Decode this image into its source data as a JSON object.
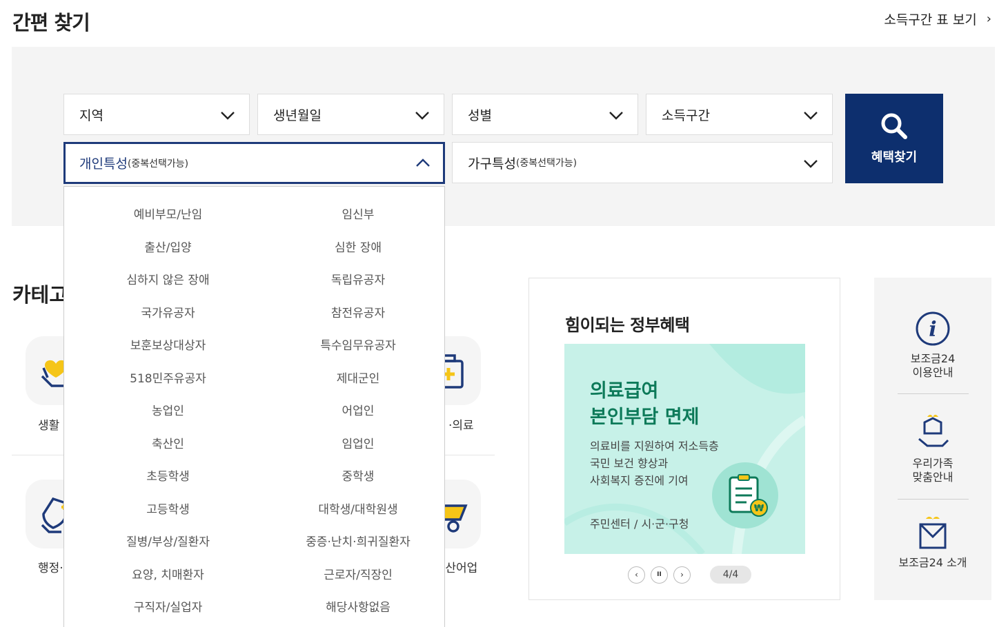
{
  "header": {
    "title": "간편 찾기",
    "income_table_link": "소득구간 표 보기",
    "link_chevron": "›"
  },
  "filters": {
    "region": "지역",
    "birthdate": "생년월일",
    "gender": "성별",
    "income": "소득구간",
    "personal": {
      "label": "개인특성",
      "sub": "(중복선택가능)"
    },
    "household": {
      "label": "가구특성",
      "sub": "(중복선택가능)"
    },
    "search_button": "혜택찾기"
  },
  "personal_options": [
    "예비부모/난임",
    "임신부",
    "출산/입양",
    "심한 장애",
    "심하지 않은 장애",
    "독립유공자",
    "국가유공자",
    "참전유공자",
    "보훈보상대상자",
    "특수임무유공자",
    "518민주유공자",
    "제대군인",
    "농업인",
    "어업인",
    "축산인",
    "임업인",
    "초등학생",
    "중학생",
    "고등학생",
    "대학생/대학원생",
    "질병/부상/질환자",
    "중증·난치·희귀질환자",
    "요양, 치매환자",
    "근로자/직장인",
    "구직자/실업자",
    "해당사항없음"
  ],
  "category": {
    "title": "카테고",
    "labels": [
      "생활",
      "·의료",
      "행정·",
      "·산어업"
    ]
  },
  "benefit": {
    "title": "힘이되는 정부혜택",
    "banner_heading_1": "의료급여",
    "banner_heading_2": "본인부담 면제",
    "banner_desc_1": "의료비를 지원하여 저소득층",
    "banner_desc_2": "국민 보건 향상과",
    "banner_desc_3": "사회복지 증진에 기여",
    "banner_footer": "주민센터 / 시·군·구청",
    "pager": "4/4",
    "prev": "‹",
    "pause": "II",
    "next": "›",
    "won_symbol": "₩"
  },
  "side": {
    "item1_line1": "보조금24",
    "item1_line2": "이용안내",
    "item2_line1": "우리가족",
    "item2_line2": "맞춤안내",
    "item3": "보조금24 소개"
  },
  "colors": {
    "navy": "#0d2f6e",
    "open_border": "#1e3a7a",
    "banner_bg": "#c7f1e8",
    "banner_heading": "#0d7a59",
    "accent_yellow": "#f5c518"
  }
}
